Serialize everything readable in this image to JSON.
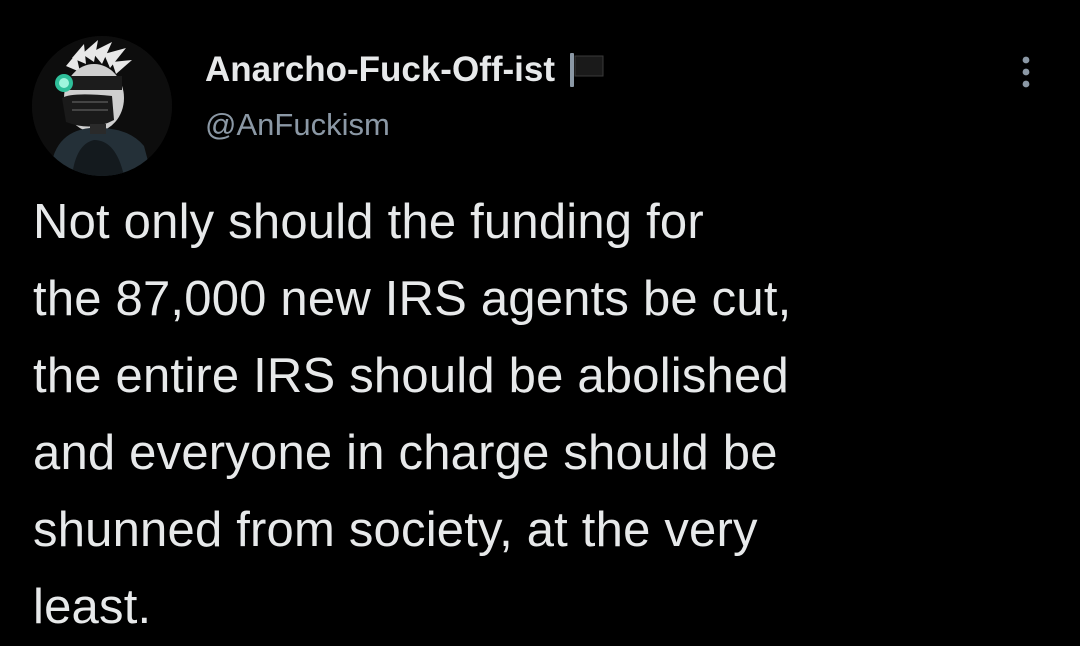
{
  "author": {
    "display_name": "Anarcho-Fuck-Off-ist",
    "handle": "@AnFuckism",
    "avatar_icon": "avatar-icon",
    "badge_icon": "black-flag-icon"
  },
  "menu": {
    "icon": "more-options-icon"
  },
  "tweet": {
    "text": "Not only should the funding for\nthe 87,000 new IRS agents be cut,\nthe entire IRS should be abolished\nand everyone in charge should be\nshunned from society, at the very\nleast."
  },
  "colors": {
    "background": "#000000",
    "text": "#e7e9ea",
    "secondary": "#8b98a5"
  }
}
